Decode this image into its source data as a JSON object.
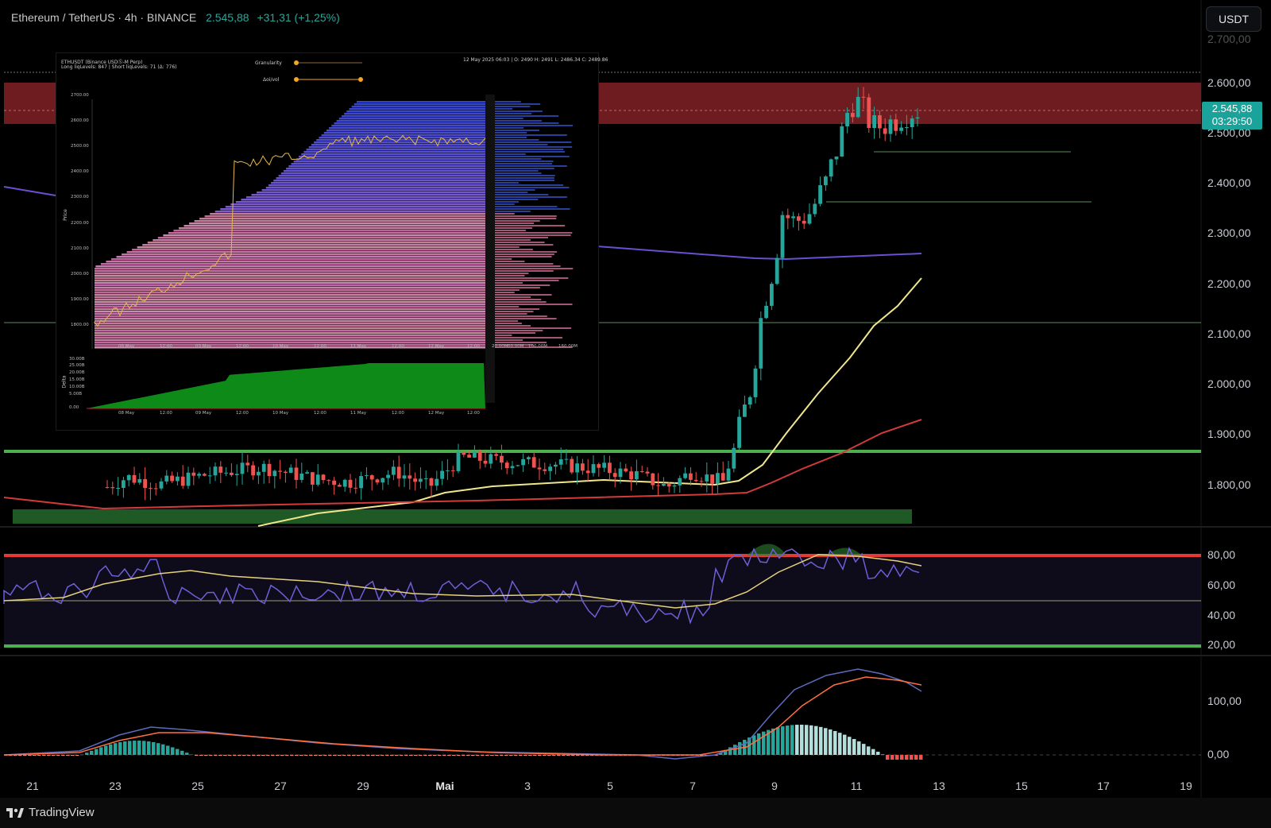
{
  "header": {
    "symbol": "Ethereum / TetherUS · 4h · BINANCE",
    "price": "2.545,88",
    "change": "+31,31 (+1,25%)"
  },
  "currency_button": "USDT",
  "price_tag": {
    "price": "2.545,88",
    "countdown": "03:29:50"
  },
  "price_axis": [
    "2.700,00",
    "2.600,00",
    "2.500,00",
    "2.400,00",
    "2.300,00",
    "2.200,00",
    "2.100,00",
    "2.000,00",
    "1.900,00",
    "1.800,00"
  ],
  "rsi_axis": [
    "80,00",
    "60,00",
    "40,00",
    "20,00"
  ],
  "macd_axis": [
    "100,00",
    "0,00"
  ],
  "time_axis": [
    "21",
    "23",
    "25",
    "27",
    "29",
    "Mai",
    "3",
    "5",
    "7",
    "9",
    "11",
    "13",
    "15",
    "17",
    "19"
  ],
  "footer": {
    "brand": "TradingView"
  },
  "inset": {
    "title_line1": "ETHUSDT (Binance USDⓈ-M Perp)",
    "title_line2": "Long liqLevels: 847 | Short liqLevels: 71 (Δ: 776)",
    "granularity_label": "Granularity",
    "oivol_label": "Δoi/vol",
    "ohlc": "12 May 2025 06:03 | O: 2490 H: 2491 L: 2486.34 C: 2489.86",
    "price_ticks": [
      "2700.00",
      "2600.00",
      "2500.00",
      "2400.00",
      "2300.00",
      "2200.00",
      "2100.00",
      "2000.00",
      "1900.00",
      "1800.00"
    ],
    "price_axis_title": "Price",
    "time_ticks": [
      "08 May",
      "12:00",
      "09 May",
      "12:00",
      "10 May",
      "12:00",
      "11 May",
      "12:00",
      "12 May",
      "12:00"
    ],
    "volume_ticks": [
      "20.00M",
      "60.00M",
      "100.00M",
      "160.00M"
    ],
    "delta_ticks": [
      "30.00B",
      "25.00B",
      "20.00B",
      "15.00B",
      "10.00B",
      "5.00B",
      "0.00"
    ],
    "delta_axis_title": "Delta"
  },
  "colors": {
    "up": "#26a69a",
    "down": "#ef5350",
    "resistance_zone": "#7a1f24",
    "support_zone": "#1f5a26",
    "ma200": "#6a4fd0",
    "ma50": "#f0e68c",
    "ma100": "#d23b3b",
    "rsi": "#6d5fd6"
  }
}
